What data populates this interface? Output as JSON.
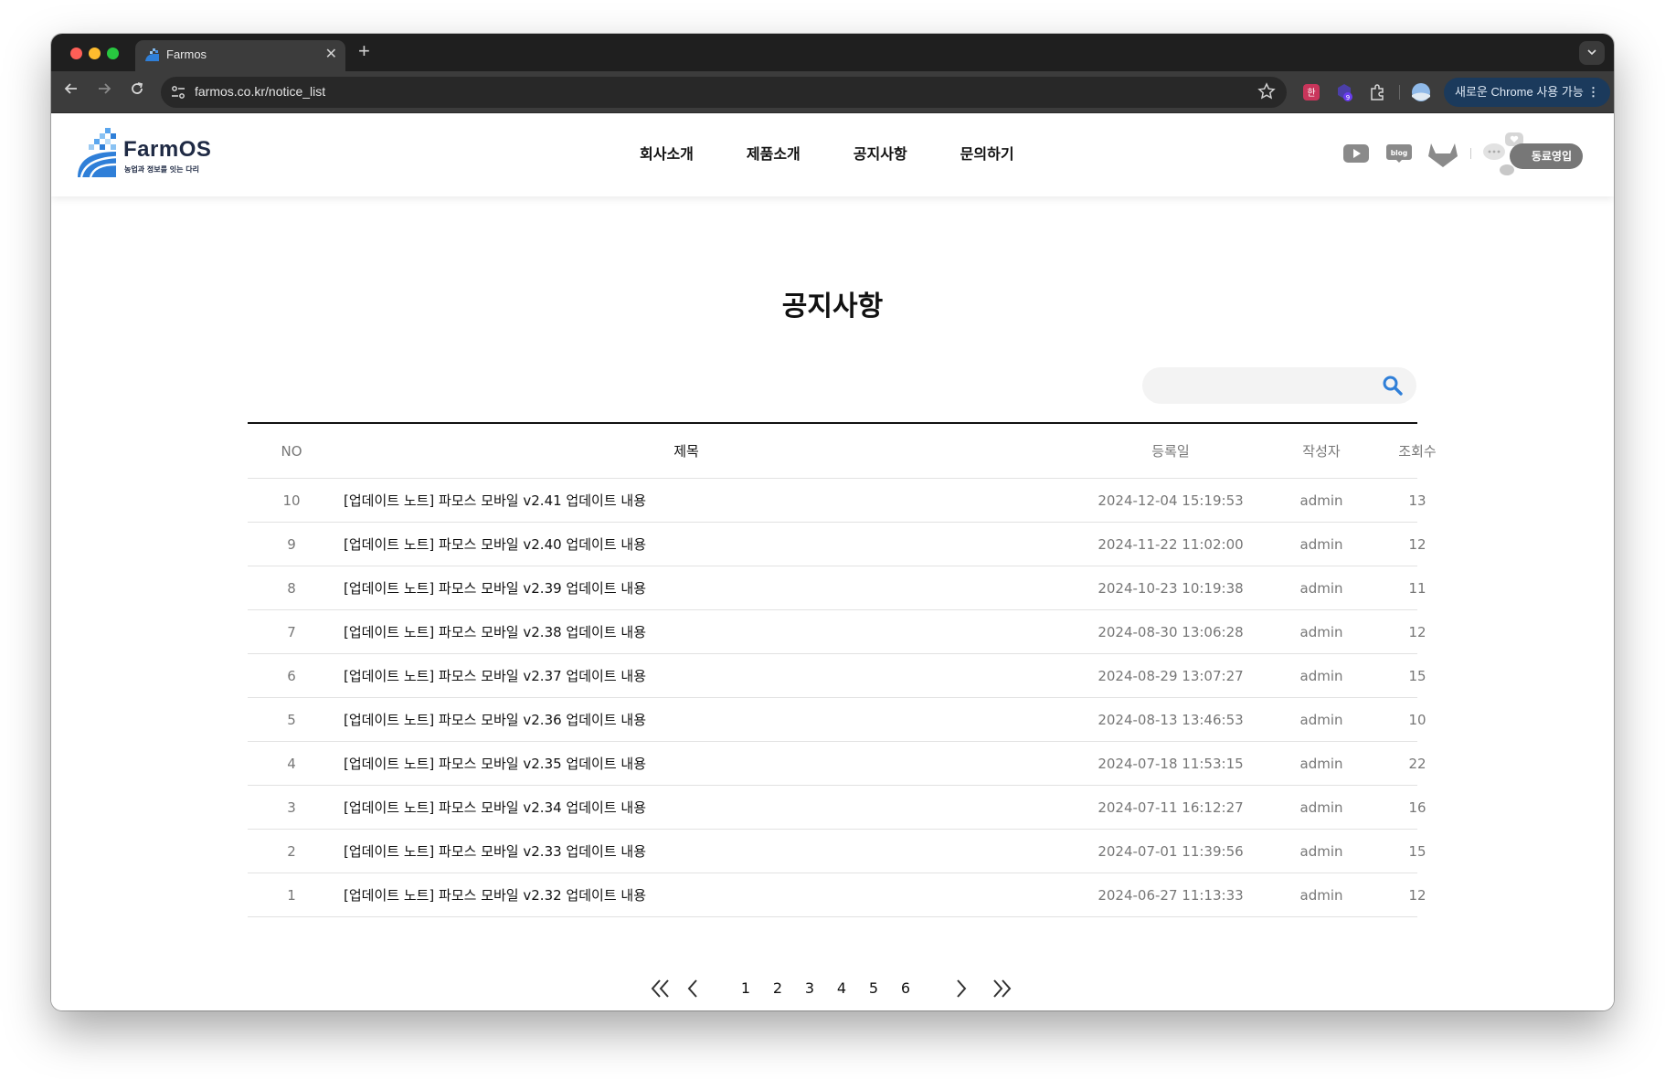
{
  "browser": {
    "tab_title": "Farmos",
    "url": "farmos.co.kr/notice_list",
    "update_label": "새로운 Chrome 사용 가능",
    "new_tab": "+",
    "close": "✕"
  },
  "header": {
    "logo_name": "FarmOS",
    "logo_tagline": "농업과 정보를 잇는 다리",
    "nav": [
      "회사소개",
      "제품소개",
      "공지사항",
      "문의하기"
    ],
    "kakao_label": "동료영입"
  },
  "page": {
    "title": "공지사항",
    "search_placeholder": ""
  },
  "table": {
    "headers": {
      "no": "NO",
      "title": "제목",
      "date": "등록일",
      "writer": "작성자",
      "views": "조회수"
    },
    "rows": [
      {
        "no": "10",
        "title": "[업데이트 노트] 파모스 모바일 v2.41 업데이트 내용",
        "date": "2024-12-04 15:19:53",
        "writer": "admin",
        "views": "13"
      },
      {
        "no": "9",
        "title": "[업데이트 노트] 파모스 모바일 v2.40 업데이트 내용",
        "date": "2024-11-22 11:02:00",
        "writer": "admin",
        "views": "12"
      },
      {
        "no": "8",
        "title": "[업데이트 노트] 파모스 모바일 v2.39 업데이트 내용",
        "date": "2024-10-23 10:19:38",
        "writer": "admin",
        "views": "11"
      },
      {
        "no": "7",
        "title": "[업데이트 노트] 파모스 모바일 v2.38 업데이트 내용",
        "date": "2024-08-30 13:06:28",
        "writer": "admin",
        "views": "12"
      },
      {
        "no": "6",
        "title": "[업데이트 노트] 파모스 모바일 v2.37 업데이트 내용",
        "date": "2024-08-29 13:07:27",
        "writer": "admin",
        "views": "15"
      },
      {
        "no": "5",
        "title": "[업데이트 노트] 파모스 모바일 v2.36 업데이트 내용",
        "date": "2024-08-13 13:46:53",
        "writer": "admin",
        "views": "10"
      },
      {
        "no": "4",
        "title": "[업데이트 노트] 파모스 모바일 v2.35 업데이트 내용",
        "date": "2024-07-18 11:53:15",
        "writer": "admin",
        "views": "22"
      },
      {
        "no": "3",
        "title": "[업데이트 노트] 파모스 모바일 v2.34 업데이트 내용",
        "date": "2024-07-11 16:12:27",
        "writer": "admin",
        "views": "16"
      },
      {
        "no": "2",
        "title": "[업데이트 노트] 파모스 모바일 v2.33 업데이트 내용",
        "date": "2024-07-01 11:39:56",
        "writer": "admin",
        "views": "15"
      },
      {
        "no": "1",
        "title": "[업데이트 노트] 파모스 모바일 v2.32 업데이트 내용",
        "date": "2024-06-27 11:13:33",
        "writer": "admin",
        "views": "12"
      }
    ]
  },
  "pagination": {
    "pages": [
      "1",
      "2",
      "3",
      "4",
      "5",
      "6"
    ],
    "icons": [
      "first-page-icon",
      "prev-page-icon",
      "next-page-icon",
      "last-page-icon"
    ]
  },
  "colors": {
    "accent_blue": "#2f7fd8",
    "title_highlight": "#e3eefa",
    "update_chip": "#1b3a5c"
  }
}
